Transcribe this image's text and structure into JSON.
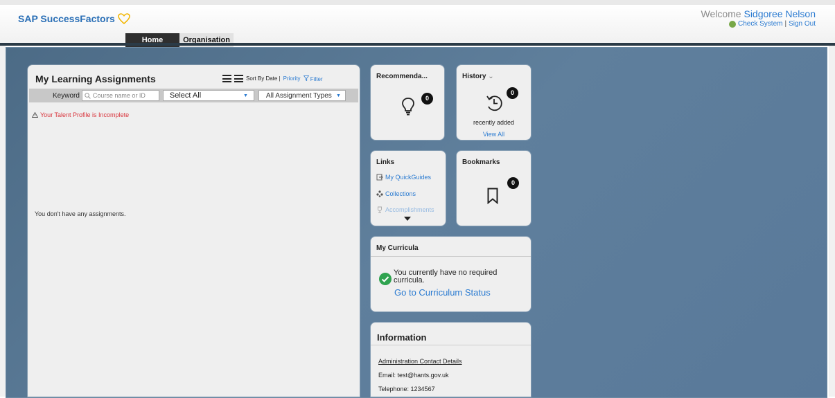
{
  "app": {
    "logo_text": "SAP SuccessFactors",
    "welcome_prefix": "Welcome",
    "user_name": "Sidgoree Nelson",
    "check_system": "Check System",
    "separator": "|",
    "sign_out": "Sign Out"
  },
  "nav": {
    "tabs": [
      {
        "label": "Home",
        "active": true
      },
      {
        "label": "Organisation",
        "active": false
      }
    ]
  },
  "learning": {
    "title": "My Learning Assignments",
    "sort_label": "Sort By Date |",
    "priority_label": "Priority",
    "filter_label": "Filter",
    "keyword_label": "Keyword",
    "search_placeholder": "Course name or ID",
    "select_all": "Select All",
    "assignment_types": "All Assignment Types",
    "warning": "Your Talent Profile is Incomplete",
    "empty_message": "You don't have any assignments."
  },
  "recommendations": {
    "title": "Recommenda...",
    "count": "0"
  },
  "history": {
    "title": "History",
    "count": "0",
    "caption": "recently added",
    "view_all": "View All"
  },
  "links": {
    "title": "Links",
    "items": [
      "My QuickGuides",
      "Collections",
      "Accomplishments"
    ]
  },
  "bookmarks": {
    "title": "Bookmarks",
    "count": "0"
  },
  "curricula": {
    "title": "My Curricula",
    "message": "You currently have no required curricula.",
    "link": "Go to Curriculum Status"
  },
  "information": {
    "title": "Information",
    "contact_heading": "Administration Contact Details",
    "email": "Email: test@hants.gov.uk",
    "telephone": "Telephone: 1234567"
  },
  "colors": {
    "brand_blue": "#2a6fb6",
    "link_blue": "#2b7bd1",
    "warning_red": "#d9343c",
    "success_green": "#2fa34f",
    "background_slate": "#5a7a98"
  }
}
